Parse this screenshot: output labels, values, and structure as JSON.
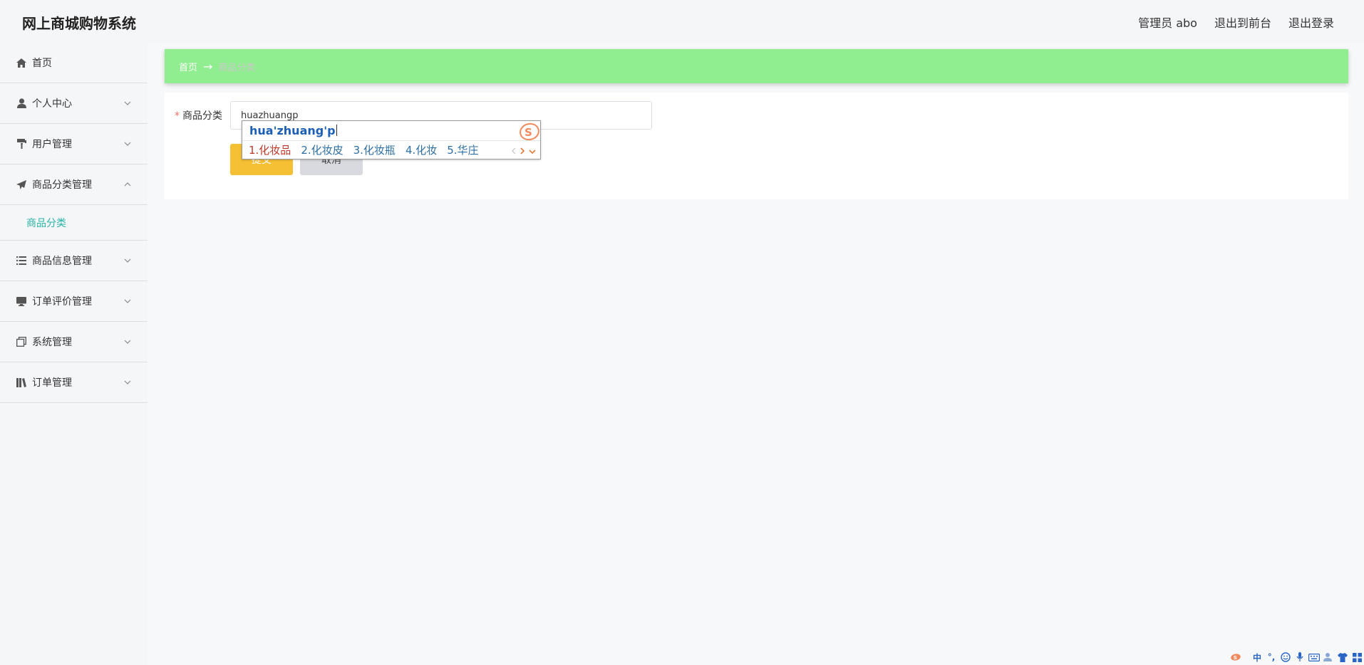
{
  "header": {
    "brand": "网上商城购物系统",
    "admin_label": "管理员 abo",
    "to_front_label": "退出到前台",
    "logout_label": "退出登录"
  },
  "sidebar": {
    "items": [
      {
        "label": "首页",
        "icon": "home-icon"
      },
      {
        "label": "个人中心",
        "icon": "user-icon"
      },
      {
        "label": "用户管理",
        "icon": "paint-roller-icon"
      },
      {
        "label": "商品分类管理",
        "icon": "paper-plane-icon",
        "expanded": true
      },
      {
        "label": "商品信息管理",
        "icon": "list-icon"
      },
      {
        "label": "订单评价管理",
        "icon": "monitor-icon"
      },
      {
        "label": "系统管理",
        "icon": "copy-icon"
      },
      {
        "label": "订单管理",
        "icon": "book-icon"
      }
    ],
    "submenu": {
      "label": "商品分类"
    }
  },
  "breadcrumb": {
    "home": "首页",
    "separator": "→",
    "current": "商品分类"
  },
  "form": {
    "required_mark": "*",
    "field_label": "商品分类",
    "field_value": "huazhuangp",
    "submit_label": "提交",
    "cancel_label": "取消"
  },
  "ime": {
    "composition": "hua'zhuang'p",
    "candidates": [
      "1.化妆品",
      "2.化妆皮",
      "3.化妆瓶",
      "4.化妆",
      "5.华庄"
    ]
  },
  "tray": {
    "mode_label": "中",
    "punct_label": "°,"
  },
  "colors": {
    "breadcrumb_bg": "#90ee90",
    "submenu_active": "#2bb3a7",
    "submit_bg": "#f6c034",
    "cancel_bg": "#d8dadf",
    "required": "#f56c6c"
  }
}
